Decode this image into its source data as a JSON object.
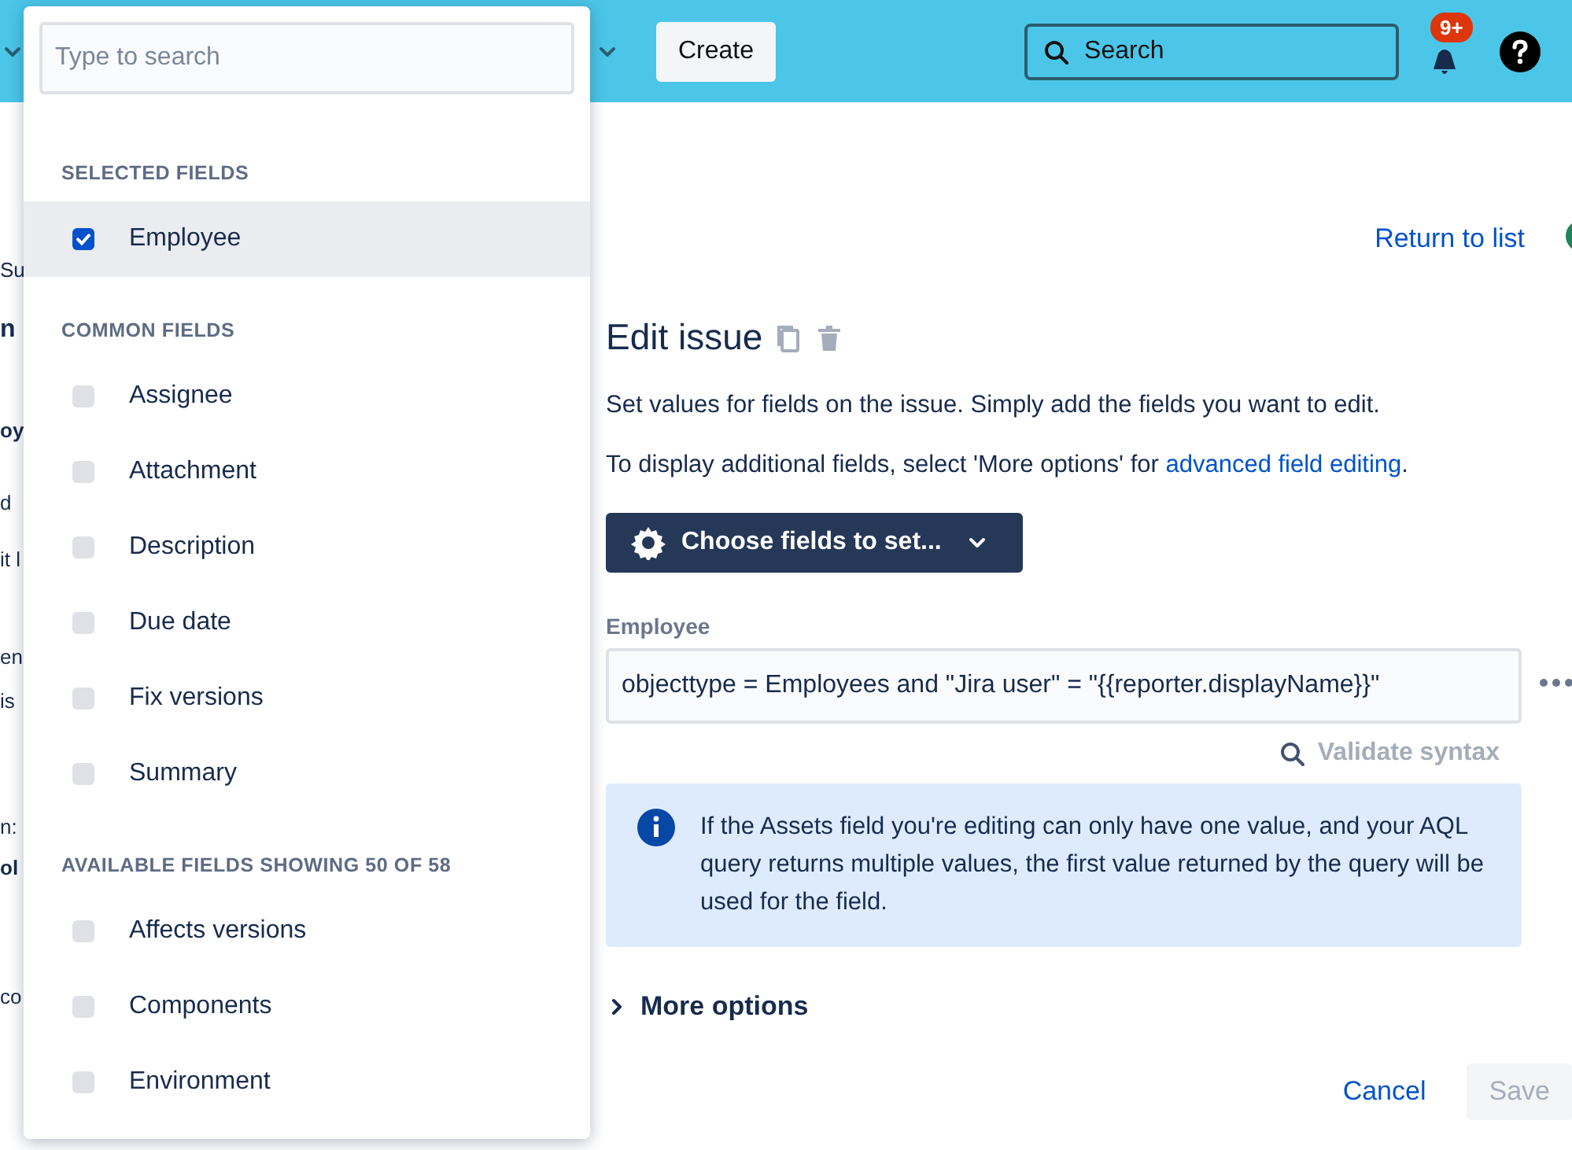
{
  "top_bar": {
    "create_button": "Create",
    "search": {
      "placeholder": "Search"
    },
    "notification_badge": "9+"
  },
  "background_fragments": [
    {
      "text": "Su",
      "kind": "plain"
    },
    {
      "text": "n",
      "kind": "heading"
    },
    {
      "text": "oy",
      "kind": "bold"
    },
    {
      "text": "d",
      "kind": "plain"
    },
    {
      "text": "it l",
      "kind": "plain"
    },
    {
      "text": "en",
      "kind": "plain"
    },
    {
      "text": "is",
      "kind": "plain"
    },
    {
      "text": "n:",
      "kind": "plain"
    },
    {
      "text": "ol",
      "kind": "bold"
    },
    {
      "text": "co",
      "kind": "plain"
    }
  ],
  "field_picker": {
    "search": {
      "placeholder": "Type to search"
    },
    "sections": [
      {
        "heading": "SELECTED FIELDS",
        "items": [
          {
            "label": "Employee",
            "checked": true,
            "selected": true
          }
        ]
      },
      {
        "heading": "COMMON FIELDS",
        "items": [
          {
            "label": "Assignee",
            "checked": false,
            "selected": false
          },
          {
            "label": "Attachment",
            "checked": false,
            "selected": false
          },
          {
            "label": "Description",
            "checked": false,
            "selected": false
          },
          {
            "label": "Due date",
            "checked": false,
            "selected": false
          },
          {
            "label": "Fix versions",
            "checked": false,
            "selected": false
          },
          {
            "label": "Summary",
            "checked": false,
            "selected": false
          }
        ]
      },
      {
        "heading": "AVAILABLE FIELDS SHOWING 50 OF 58",
        "items": [
          {
            "label": "Affects versions",
            "checked": false,
            "selected": false
          },
          {
            "label": "Components",
            "checked": false,
            "selected": false
          },
          {
            "label": "Environment",
            "checked": false,
            "selected": false
          }
        ]
      }
    ]
  },
  "return_link": "Return to list",
  "action": {
    "title": "Edit issue",
    "description": "Set values for fields on the issue. Simply add the fields you want to edit.",
    "hint": "To display additional fields, select 'More options' for ",
    "hint_link": "advanced field editing",
    "hint_end": ".",
    "choose_button": "Choose fields to set...",
    "field": {
      "label": "Employee",
      "value": "objecttype = Employees and \"Jira user\" = \"{{reporter.displayName}}\""
    },
    "validate": "Validate syntax",
    "info": "If the Assets field you're editing can only have one value, and your AQL query returns multiple values, the first value returned by the query will be used for the field.",
    "more_options": {
      "label": "More options",
      "expanded": false
    },
    "cancel": "Cancel",
    "save": {
      "label": "Save",
      "disabled": true
    }
  }
}
